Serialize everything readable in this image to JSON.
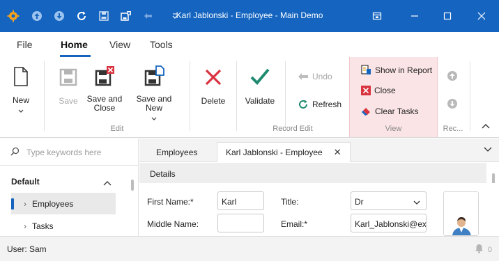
{
  "window": {
    "title": "Karl Jablonski - Employee - Main Demo"
  },
  "quick_access": {
    "icons": [
      "app-gear-icon",
      "upload-icon",
      "download-icon",
      "refresh-icon",
      "save-icon",
      "save-close-icon",
      "undo-icon",
      "customize-dropdown-icon"
    ]
  },
  "ribbon_tabs": [
    {
      "label": "File"
    },
    {
      "label": "Home",
      "active": true
    },
    {
      "label": "View"
    },
    {
      "label": "Tools"
    }
  ],
  "ribbon": {
    "new": "New",
    "save": "Save",
    "save_close_line1": "Save and",
    "save_close_line2": "Close",
    "save_new": "Save and New",
    "delete": "Delete",
    "edit_group": "Edit",
    "validate": "Validate",
    "undo": "Undo",
    "refresh": "Refresh",
    "record_edit_group": "Record Edit",
    "show_in_report": "Show in Report",
    "close": "Close",
    "clear_tasks": "Clear Tasks",
    "view_group": "View",
    "records_group": "Rec..."
  },
  "nav": {
    "search_placeholder": "Type keywords here",
    "group": "Default",
    "items": [
      {
        "label": "Employees",
        "selected": true
      },
      {
        "label": "Tasks"
      }
    ]
  },
  "doc_tabs": [
    {
      "label": "Employees"
    },
    {
      "label": "Karl Jablonski - Employee",
      "active": true
    }
  ],
  "details": {
    "header": "Details",
    "first_name_label": "First Name:*",
    "first_name_value": "Karl",
    "middle_name_label": "Middle Name:",
    "middle_name_value": "",
    "title_label": "Title:",
    "title_value": "Dr",
    "email_label": "Email:*",
    "email_value": "Karl_Jablonski@exa"
  },
  "status": {
    "user": "User: Sam",
    "notifications": "0"
  },
  "colors": {
    "accent": "#1565c0",
    "view_group_bg": "#fbe4e6",
    "delete_red": "#d9333f",
    "validate_green": "#1f8a70"
  }
}
